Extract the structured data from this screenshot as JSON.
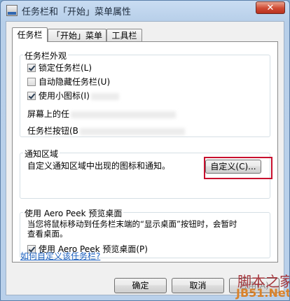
{
  "window": {
    "title": "任务栏和「开始」菜单属性",
    "close_symbol": "✕"
  },
  "tabs": [
    {
      "label": "任务栏",
      "active": true
    },
    {
      "label": "「开始」菜单",
      "active": false
    },
    {
      "label": "工具栏",
      "active": false
    }
  ],
  "appearance": {
    "legend": "任务栏外观",
    "lock": {
      "label": "锁定任务栏(L)",
      "checked": true
    },
    "autohide": {
      "label": "自动隐藏任务栏(U)",
      "checked": false
    },
    "small_icons": {
      "label": "使用小图标(I)",
      "checked": true
    },
    "location_label": "屏幕上的任",
    "buttons_label": "任务栏按钮(B"
  },
  "notification": {
    "legend": "通知区域",
    "description": "自定义通知区域中出现的图标和通知。",
    "customize_button": "自定义(C)..."
  },
  "aero_peek": {
    "legend": "使用 Aero Peek 预览桌面",
    "description_line1": "当您将鼠标移动到任务栏末端的“显示桌面”按钮时，会暂时",
    "description_line2": "查看桌面。",
    "checkbox": {
      "label": "使用 Aero Peek 预览桌面(P)",
      "checked": true
    }
  },
  "help_link": "如何自定义该任务栏?",
  "footer": {
    "ok": "确定",
    "cancel": "取消",
    "apply": "应用(A)"
  },
  "watermark": {
    "line1": "脚本之家",
    "line2": "JB51.Net"
  },
  "colors": {
    "highlight_border": "#c8102e",
    "link": "#1a5fbf"
  }
}
